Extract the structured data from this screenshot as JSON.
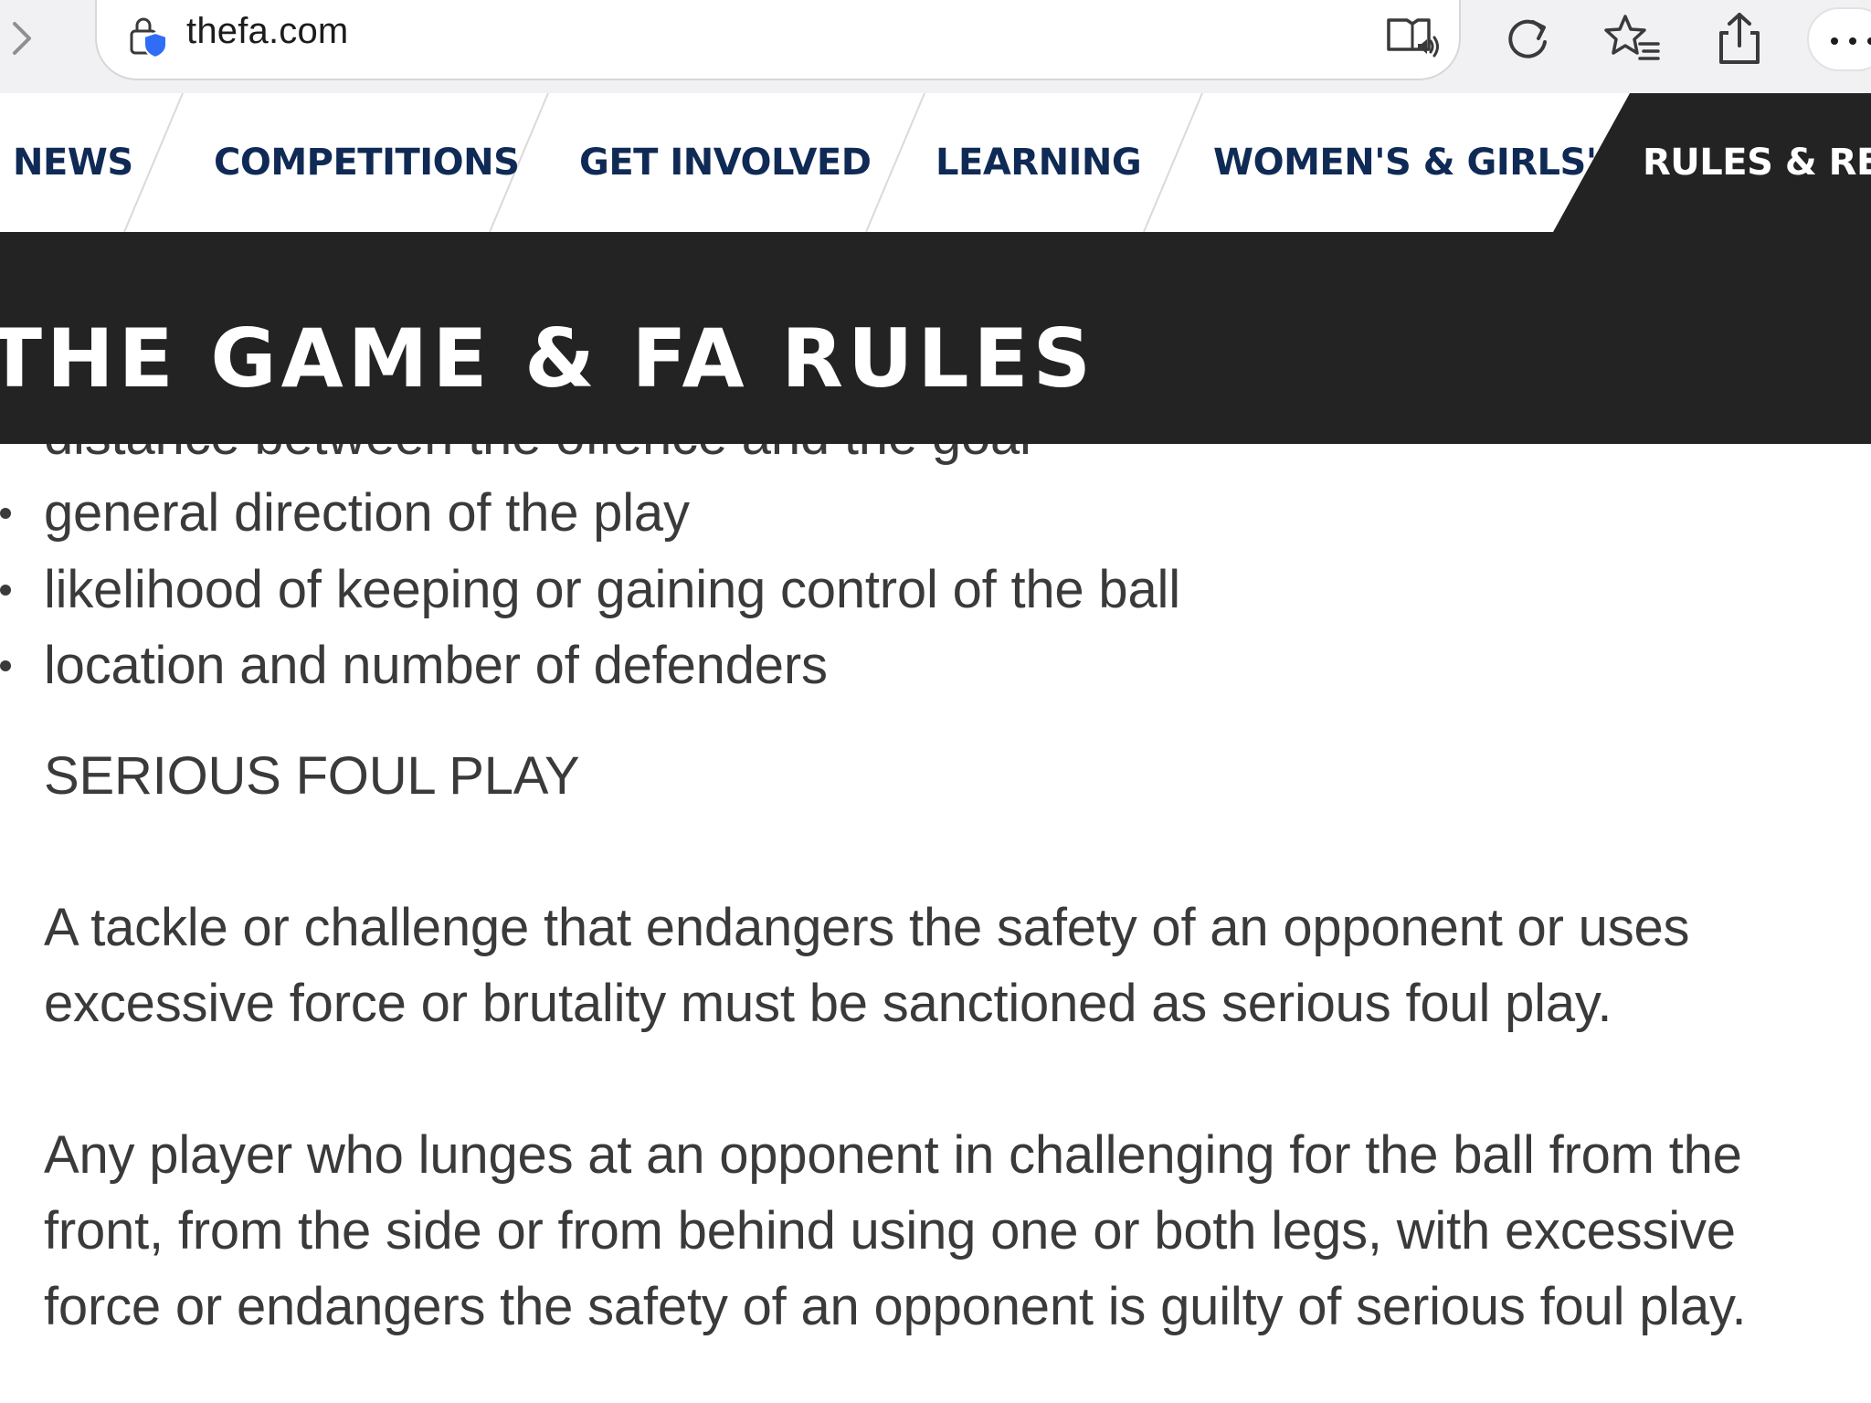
{
  "browser": {
    "url": "thefa.com"
  },
  "nav": {
    "items": [
      {
        "label": "NEWS"
      },
      {
        "label": "COMPETITIONS"
      },
      {
        "label": "GET INVOLVED"
      },
      {
        "label": "LEARNING"
      },
      {
        "label": "WOMEN'S & GIRLS'"
      },
      {
        "label": "RULES & REG"
      }
    ],
    "active_index": 5
  },
  "page": {
    "title": "THE GAME & FA RULES"
  },
  "article": {
    "clipped_line": "distance between the offence and the goal",
    "bullets": [
      "general direction of the play",
      "likelihood of keeping or gaining control of the ball",
      "location and number of defenders"
    ],
    "heading": "SERIOUS FOUL PLAY",
    "paragraphs": [
      "A tackle or challenge that endangers the safety of an opponent or uses excessive force or brutality must be sanctioned as serious foul play.",
      "Any player who lunges at an opponent in challenging for the ball from the front, from the side or from behind using one or both legs, with excessive force or endangers the safety of an opponent is guilty of serious foul play."
    ]
  },
  "colors": {
    "nav_text": "#0f2a55",
    "dark_band": "#232323",
    "body_text": "#3a3a3a",
    "lock_shield": "#2f6df6"
  }
}
